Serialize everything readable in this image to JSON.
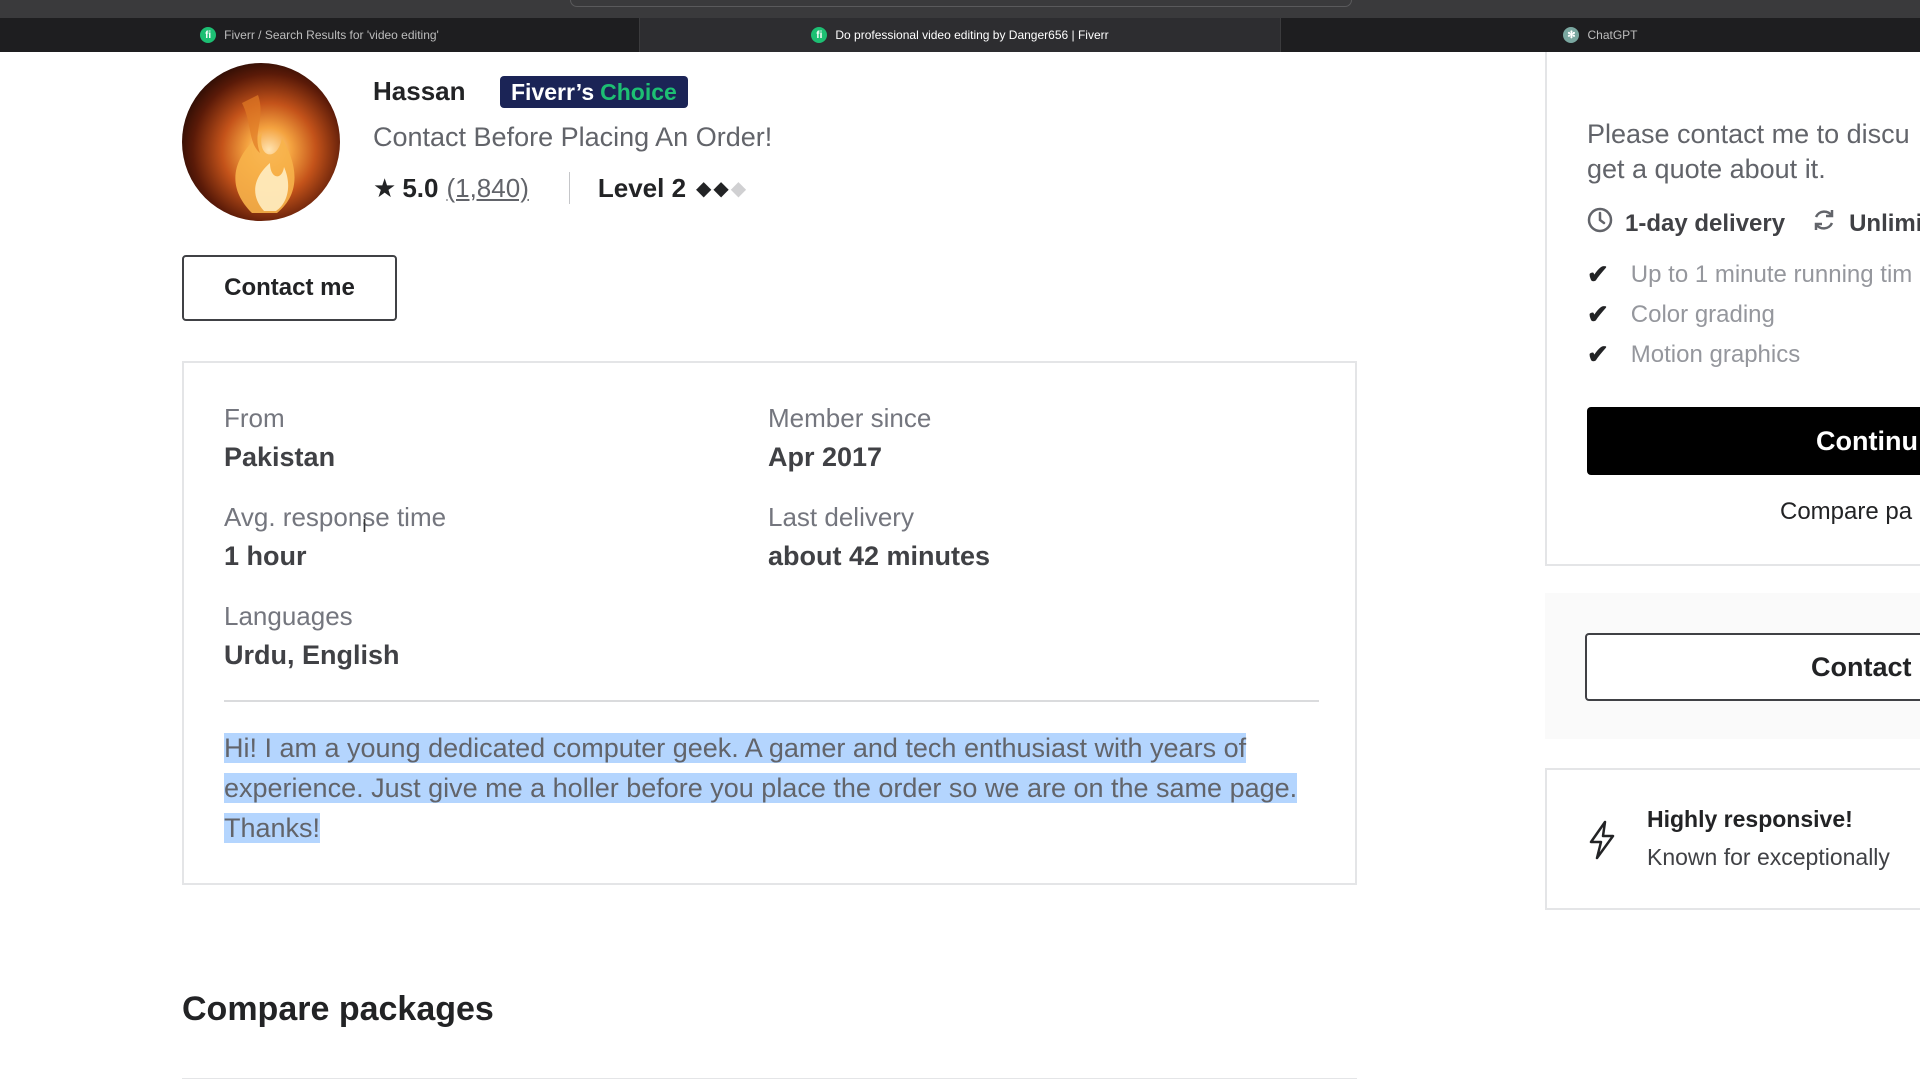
{
  "browser": {
    "tabs": [
      {
        "title": "Fiverr / Search Results for 'video editing'",
        "icon": "fiverr-favicon",
        "active": false
      },
      {
        "title": "Do professional video editing by Danger656 | Fiverr",
        "icon": "fiverr-favicon",
        "active": true
      },
      {
        "title": "ChatGPT",
        "icon": "chatgpt-favicon",
        "active": false
      }
    ]
  },
  "seller": {
    "name": "Hassan",
    "badge_part1": "Fiverr’s",
    "badge_part2": "Choice",
    "tagline": "Contact Before Placing An Order!",
    "rating": "5.0",
    "reviews": "(1,840)",
    "level": "Level 2",
    "level_diamonds_filled": 2,
    "level_diamonds_total": 3,
    "contact_button": "Contact me"
  },
  "about": {
    "from_label": "From",
    "from_value": "Pakistan",
    "member_label": "Member since",
    "member_value": "Apr 2017",
    "response_label": "Avg. response time",
    "response_value": "1 hour",
    "delivery_label": "Last delivery",
    "delivery_value": "about 42 minutes",
    "languages_label": "Languages",
    "languages_value": "Urdu, English",
    "bio": "Hi! I am a young dedicated computer geek. A gamer and tech enthusiast with years of experience. Just give me a holler before you place the order so we are on the same page. Thanks!"
  },
  "compare_title": "Compare packages",
  "sidebar": {
    "description_line1": "Please contact me to discu",
    "description_line2": "get a quote about it.",
    "delivery": "1-day delivery",
    "revisions": "Unlimi",
    "features": [
      "Up to 1 minute running tim",
      "Color grading",
      "Motion graphics"
    ],
    "continue_button": "Continu",
    "compare_link": "Compare pa",
    "contact_button": "Contact",
    "responsive_title": "Highly responsive!",
    "responsive_sub": "Known for exceptionally"
  },
  "colors": {
    "fiverr_green": "#1dbf73",
    "badge_navy": "#1b2456",
    "selection": "#b4d5fe"
  }
}
